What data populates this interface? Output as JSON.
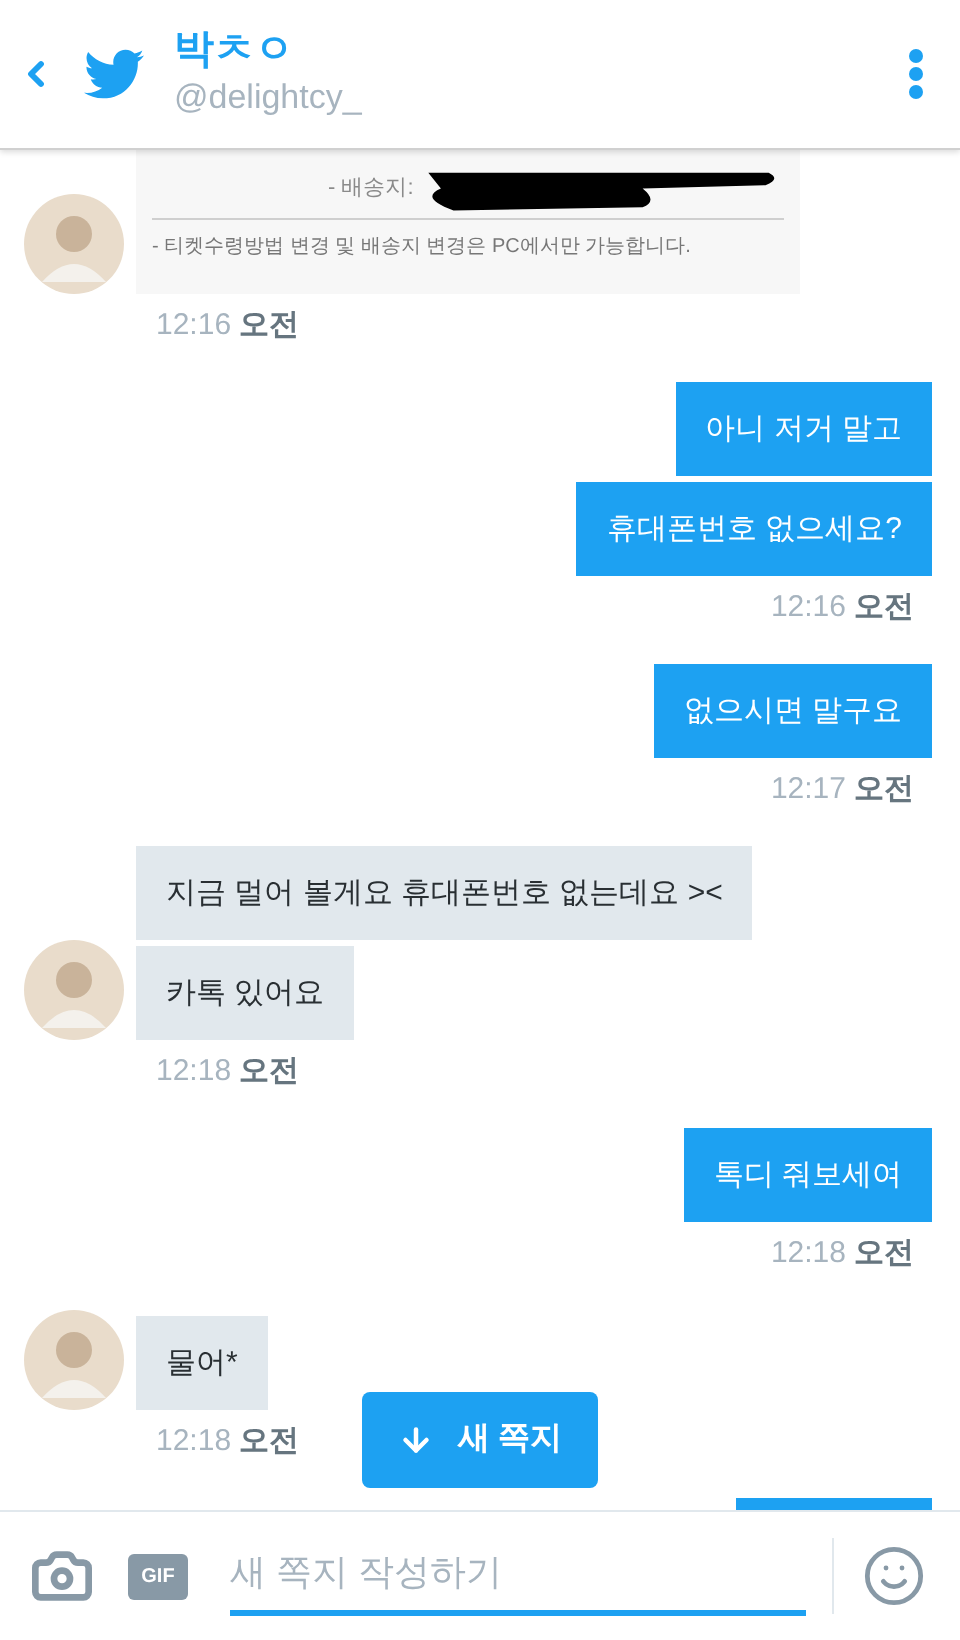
{
  "header": {
    "title": "박ㅊㅇ",
    "handle": "@delightcy_"
  },
  "groups": [
    {
      "kind": "received",
      "items": [
        {
          "kind": "image",
          "address_label": "- 배송지:",
          "note": "- 티켓수령방법 변경 및 배송지 변경은 PC에서만 가능합니다."
        }
      ],
      "time": "12:16",
      "period": "오전"
    },
    {
      "kind": "sent",
      "items": [
        {
          "kind": "text",
          "text": "아니 저거 말고"
        },
        {
          "kind": "text",
          "text": "휴대폰번호 없으세요?"
        }
      ],
      "time": "12:16",
      "period": "오전"
    },
    {
      "kind": "sent",
      "items": [
        {
          "kind": "text",
          "text": "없으시면 말구요"
        }
      ],
      "time": "12:17",
      "period": "오전"
    },
    {
      "kind": "received",
      "items": [
        {
          "kind": "text",
          "text": "지금 멀어 볼게요 휴대폰번호 없는데요 ><"
        },
        {
          "kind": "text",
          "text": "카톡 있어요"
        }
      ],
      "time": "12:18",
      "period": "오전"
    },
    {
      "kind": "sent",
      "items": [
        {
          "kind": "text",
          "text": "톡디 줘보세여"
        }
      ],
      "time": "12:18",
      "period": "오전"
    },
    {
      "kind": "received",
      "items": [
        {
          "kind": "text",
          "text": "물어*"
        }
      ],
      "time": "12:18",
      "period": "오전"
    },
    {
      "kind": "sent",
      "items": [
        {
          "kind": "partial"
        }
      ]
    }
  ],
  "new_message_button": {
    "label": "새 쪽지"
  },
  "composer": {
    "gif_label": "GIF",
    "placeholder": "새 쪽지 작성하기"
  }
}
